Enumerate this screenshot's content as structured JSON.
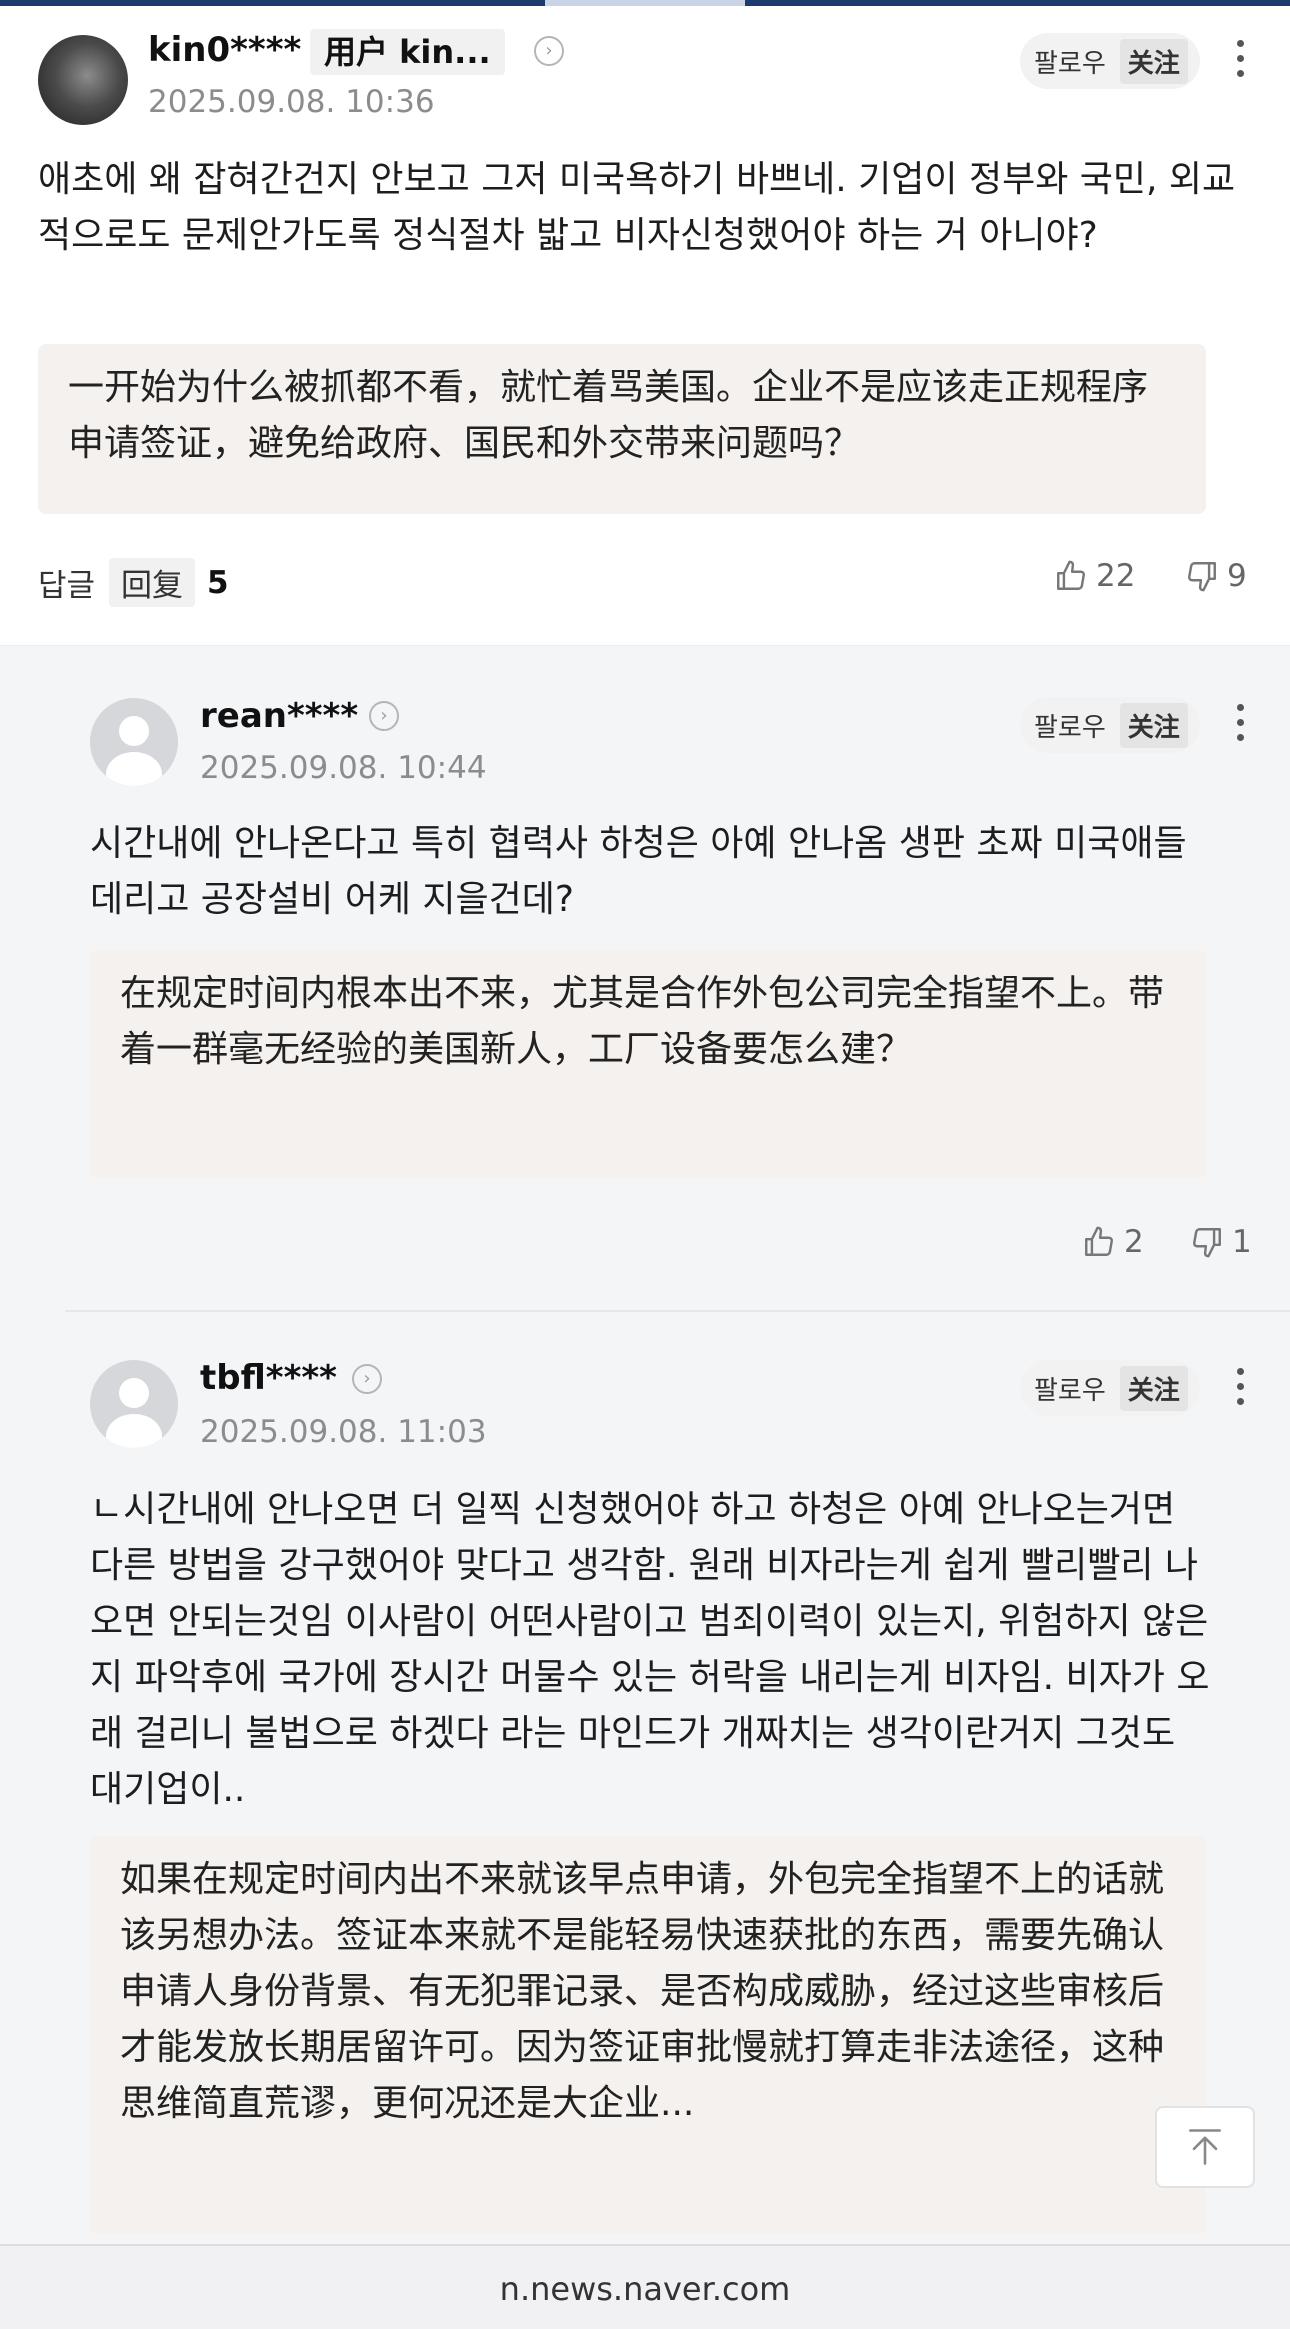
{
  "footer": {
    "url": "n.news.naver.com"
  },
  "follow": {
    "ko": "팔로우",
    "zh": "关注"
  },
  "main_comment": {
    "username": "kin0****",
    "user_tag": "用户 kin...",
    "timestamp": "2025.09.08. 10:36",
    "text_ko": "애초에 왜 잡혀간건지 안보고 그저 미국욕하기 바쁘네. 기업이 정부와 국민, 외교적으로도 문제안가도록 정식절차 밟고 비자신청했어야 하는 거 아니야?",
    "text_zh": "一开始为什么被抓都不看，就忙着骂美国。企业不是应该走正规程序申请签证，避免给政府、国民和外交带来问题吗？",
    "reply_label_ko": "답글",
    "reply_label_zh": "回复",
    "reply_count": "5",
    "likes": "22",
    "dislikes": "9"
  },
  "replies": [
    {
      "username": "rean****",
      "timestamp": "2025.09.08. 10:44",
      "text_ko": "시간내에 안나온다고 특히 협력사 하청은 아예 안나옴 생판 초짜 미국애들 데리고 공장설비 어케 지을건데?",
      "text_zh": "在规定时间内根本出不来，尤其是合作外包公司完全指望不上。带着一群毫无经验的美国新人，工厂设备要怎么建？",
      "likes": "2",
      "dislikes": "1"
    },
    {
      "username": "tbfl****",
      "timestamp": "2025.09.08. 11:03",
      "text_ko": "ㄴ시간내에 안나오면 더 일찍 신청했어야 하고 하청은 아예 안나오는거면 다른 방법을 강구했어야 맞다고 생각함. 원래 비자라는게 쉽게 빨리빨리 나오면 안되는것임 이사람이 어떤사람이고 범죄이력이 있는지, 위험하지 않은지 파악후에 국가에 장시간 머물수 있는 허락을 내리는게 비자임. 비자가 오래 걸리니 불법으로 하겠다 라는 마인드가 개짜치는 생각이란거지 그것도 대기업이..",
      "text_zh": "如果在规定时间内出不来就该早点申请，外包完全指望不上的话就该另想办法。签证本来就不是能轻易快速获批的东西，需要先确认申请人身份背景、有无犯罪记录、是否构成威胁，经过这些审核后才能发放长期居留许可。因为签证审批慢就打算走非法途径，这种思维简直荒谬，更何况还是大企业..."
    }
  ]
}
